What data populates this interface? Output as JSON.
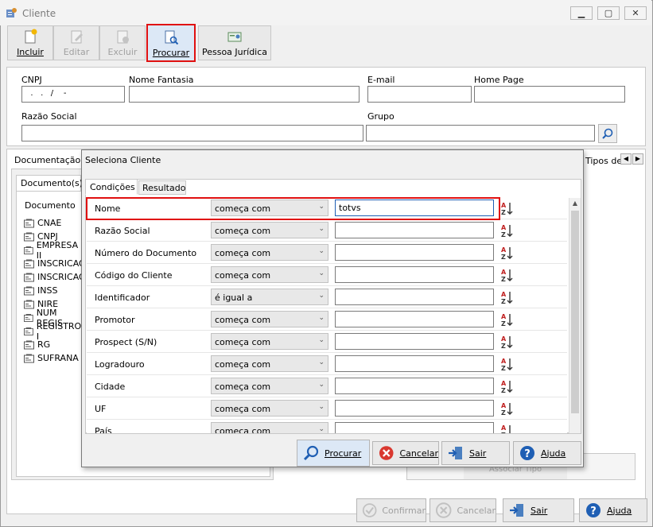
{
  "window": {
    "title": "Cliente",
    "minimize": "▁",
    "restore": "▢",
    "close": "✕"
  },
  "toolbar": {
    "incluir": "Incluir",
    "editar": "Editar",
    "excluir": "Excluir",
    "procurar": "Procurar",
    "pessoa_juridica": "Pessoa Jurídica"
  },
  "form": {
    "cnpj_label": "CNPJ",
    "cnpj_value": "  .   .   /    -  ",
    "nome_fantasia_label": "Nome Fantasia",
    "email_label": "E-mail",
    "home_page_label": "Home Page",
    "razao_social_label": "Razão Social",
    "grupo_label": "Grupo"
  },
  "tabs": {
    "documentacao": "Documentação",
    "tipos": "Tipos de"
  },
  "left_panel": {
    "tab": "Documento(s)",
    "header": "Documento",
    "items": [
      "CNAE",
      "CNPJ",
      "EMPRESA II",
      "INSCRICAO",
      "INSCRICAO",
      "INSS",
      "NIRE",
      "NUM REGIS",
      "REGISTRO I",
      "RG",
      "SUFRANA"
    ]
  },
  "dialog": {
    "title": "Seleciona Cliente",
    "tabs": [
      "Condições",
      "Resultado"
    ],
    "rows": [
      {
        "label": "Nome",
        "operator": "começa com",
        "value": "totvs"
      },
      {
        "label": "Razão Social",
        "operator": "começa com",
        "value": ""
      },
      {
        "label": "Número do Documento",
        "operator": "começa com",
        "value": ""
      },
      {
        "label": "Código do Cliente",
        "operator": "começa com",
        "value": ""
      },
      {
        "label": "Identificador",
        "operator": "é igual a",
        "value": ""
      },
      {
        "label": "Promotor",
        "operator": "começa com",
        "value": ""
      },
      {
        "label": "Prospect (S/N)",
        "operator": "começa com",
        "value": ""
      },
      {
        "label": "Logradouro",
        "operator": "começa com",
        "value": ""
      },
      {
        "label": "Cidade",
        "operator": "começa com",
        "value": ""
      },
      {
        "label": "UF",
        "operator": "começa com",
        "value": ""
      },
      {
        "label": "País",
        "operator": "começa com",
        "value": ""
      }
    ],
    "buttons": {
      "procurar": "Procurar",
      "cancelar": "Cancelar",
      "sair": "Sair",
      "ajuda": "Ajuda"
    }
  },
  "bg_button": "Associar Tipo",
  "bottom": {
    "confirmar": "Confirmar",
    "cancelar": "Cancelar",
    "sair": "Sair",
    "ajuda": "Ajuda"
  },
  "colors": {
    "highlight": "#e01010",
    "accent": "#1f5fb4"
  }
}
